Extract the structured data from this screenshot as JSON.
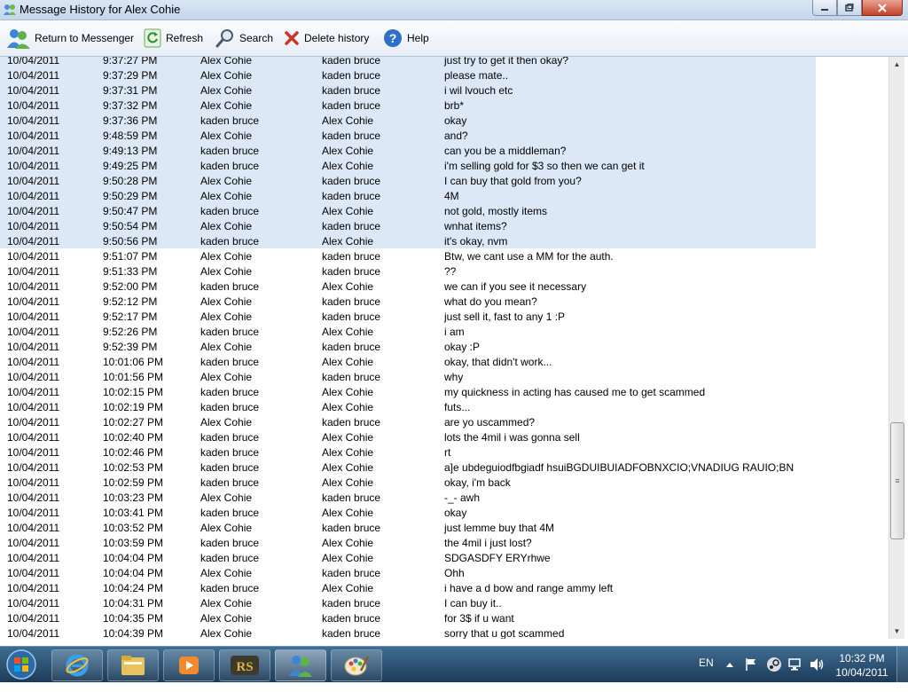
{
  "window": {
    "title": "Message History for Alex Cohie"
  },
  "toolbar": {
    "return": "Return to Messenger",
    "refresh": "Refresh",
    "search": "Search",
    "delete": "Delete history",
    "help": "Help"
  },
  "messages": [
    {
      "date": "10/04/2011",
      "time": "9:37:27 PM",
      "from": "Alex Cohie",
      "to": "kaden bruce",
      "text": "just try to get it then okay?",
      "selected": true
    },
    {
      "date": "10/04/2011",
      "time": "9:37:29 PM",
      "from": "Alex Cohie",
      "to": "kaden bruce",
      "text": "please mate..",
      "selected": true
    },
    {
      "date": "10/04/2011",
      "time": "9:37:31 PM",
      "from": "Alex Cohie",
      "to": "kaden bruce",
      "text": "i wil lvouch etc",
      "selected": true
    },
    {
      "date": "10/04/2011",
      "time": "9:37:32 PM",
      "from": "Alex Cohie",
      "to": "kaden bruce",
      "text": "brb*",
      "selected": true
    },
    {
      "date": "10/04/2011",
      "time": "9:37:36 PM",
      "from": "kaden bruce",
      "to": "Alex Cohie",
      "text": "okay",
      "selected": true
    },
    {
      "date": "10/04/2011",
      "time": "9:48:59 PM",
      "from": "Alex Cohie",
      "to": "kaden bruce",
      "text": "and?",
      "selected": true
    },
    {
      "date": "10/04/2011",
      "time": "9:49:13 PM",
      "from": "kaden bruce",
      "to": "Alex Cohie",
      "text": "can you be a middleman?",
      "selected": true
    },
    {
      "date": "10/04/2011",
      "time": "9:49:25 PM",
      "from": "kaden bruce",
      "to": "Alex Cohie",
      "text": "i'm selling gold for $3 so then we can get it",
      "selected": true
    },
    {
      "date": "10/04/2011",
      "time": "9:50:28 PM",
      "from": "Alex Cohie",
      "to": "kaden bruce",
      "text": "I can buy that gold from you?",
      "selected": true
    },
    {
      "date": "10/04/2011",
      "time": "9:50:29 PM",
      "from": "Alex Cohie",
      "to": "kaden bruce",
      "text": "4M",
      "selected": true
    },
    {
      "date": "10/04/2011",
      "time": "9:50:47 PM",
      "from": "kaden bruce",
      "to": "Alex Cohie",
      "text": "not gold, mostly items",
      "selected": true
    },
    {
      "date": "10/04/2011",
      "time": "9:50:54 PM",
      "from": "Alex Cohie",
      "to": "kaden bruce",
      "text": "wnhat items?",
      "selected": true
    },
    {
      "date": "10/04/2011",
      "time": "9:50:56 PM",
      "from": "kaden bruce",
      "to": "Alex Cohie",
      "text": "it's okay, nvm",
      "selected": true
    },
    {
      "date": "10/04/2011",
      "time": "9:51:07 PM",
      "from": "Alex Cohie",
      "to": "kaden bruce",
      "text": "Btw, we cant use a MM for the auth.",
      "selected": false
    },
    {
      "date": "10/04/2011",
      "time": "9:51:33 PM",
      "from": "Alex Cohie",
      "to": "kaden bruce",
      "text": "??",
      "selected": false
    },
    {
      "date": "10/04/2011",
      "time": "9:52:00 PM",
      "from": "kaden bruce",
      "to": "Alex Cohie",
      "text": "we can if you see it necessary",
      "selected": false
    },
    {
      "date": "10/04/2011",
      "time": "9:52:12 PM",
      "from": "Alex Cohie",
      "to": "kaden bruce",
      "text": "what do you mean?",
      "selected": false
    },
    {
      "date": "10/04/2011",
      "time": "9:52:17 PM",
      "from": "Alex Cohie",
      "to": "kaden bruce",
      "text": "just sell it, fast to any 1 :P",
      "selected": false
    },
    {
      "date": "10/04/2011",
      "time": "9:52:26 PM",
      "from": "kaden bruce",
      "to": "Alex Cohie",
      "text": "i am",
      "selected": false
    },
    {
      "date": "10/04/2011",
      "time": "9:52:39 PM",
      "from": "Alex Cohie",
      "to": "kaden bruce",
      "text": "okay :P",
      "selected": false
    },
    {
      "date": "10/04/2011",
      "time": "10:01:06 PM",
      "from": "kaden bruce",
      "to": "Alex Cohie",
      "text": "okay, that didn't work...",
      "selected": false
    },
    {
      "date": "10/04/2011",
      "time": "10:01:56 PM",
      "from": "Alex Cohie",
      "to": "kaden bruce",
      "text": "why",
      "selected": false
    },
    {
      "date": "10/04/2011",
      "time": "10:02:15 PM",
      "from": "kaden bruce",
      "to": "Alex Cohie",
      "text": "my quickness in acting has caused me to get scammed",
      "selected": false
    },
    {
      "date": "10/04/2011",
      "time": "10:02:19 PM",
      "from": "kaden bruce",
      "to": "Alex Cohie",
      "text": "futs...",
      "selected": false
    },
    {
      "date": "10/04/2011",
      "time": "10:02:27 PM",
      "from": "Alex Cohie",
      "to": "kaden bruce",
      "text": "are yo uscammed?",
      "selected": false
    },
    {
      "date": "10/04/2011",
      "time": "10:02:40 PM",
      "from": "kaden bruce",
      "to": "Alex Cohie",
      "text": "lots the 4mil i was gonna sell",
      "selected": false
    },
    {
      "date": "10/04/2011",
      "time": "10:02:46 PM",
      "from": "kaden bruce",
      "to": "Alex Cohie",
      "text": "rt",
      "selected": false
    },
    {
      "date": "10/04/2011",
      "time": "10:02:53 PM",
      "from": "kaden bruce",
      "to": "Alex Cohie",
      "text": "a]e ubdeguiodfbgiadf hsuiBGDUIBUIADFOBNXCIO;VNADIUG RAUIO;BN",
      "selected": false
    },
    {
      "date": "10/04/2011",
      "time": "10:02:59 PM",
      "from": "kaden bruce",
      "to": "Alex Cohie",
      "text": "okay, i'm back",
      "selected": false
    },
    {
      "date": "10/04/2011",
      "time": "10:03:23 PM",
      "from": "Alex Cohie",
      "to": "kaden bruce",
      "text": "-_- awh",
      "selected": false
    },
    {
      "date": "10/04/2011",
      "time": "10:03:41 PM",
      "from": "kaden bruce",
      "to": "Alex Cohie",
      "text": "okay",
      "selected": false
    },
    {
      "date": "10/04/2011",
      "time": "10:03:52 PM",
      "from": "Alex Cohie",
      "to": "kaden bruce",
      "text": "just lemme buy that 4M",
      "selected": false
    },
    {
      "date": "10/04/2011",
      "time": "10:03:59 PM",
      "from": "kaden bruce",
      "to": "Alex Cohie",
      "text": "the 4mil i just lost?",
      "selected": false
    },
    {
      "date": "10/04/2011",
      "time": "10:04:04 PM",
      "from": "kaden bruce",
      "to": "Alex Cohie",
      "text": "SDGASDFY ERYrhwe",
      "selected": false
    },
    {
      "date": "10/04/2011",
      "time": "10:04:04 PM",
      "from": "Alex Cohie",
      "to": "kaden bruce",
      "text": "Ohh",
      "selected": false
    },
    {
      "date": "10/04/2011",
      "time": "10:04:24 PM",
      "from": "kaden bruce",
      "to": "Alex Cohie",
      "text": "i have a d bow and range ammy left",
      "selected": false
    },
    {
      "date": "10/04/2011",
      "time": "10:04:31 PM",
      "from": "Alex Cohie",
      "to": "kaden bruce",
      "text": "I can buy it..",
      "selected": false
    },
    {
      "date": "10/04/2011",
      "time": "10:04:35 PM",
      "from": "Alex Cohie",
      "to": "kaden bruce",
      "text": "for 3$ if u want",
      "selected": false
    },
    {
      "date": "10/04/2011",
      "time": "10:04:39 PM",
      "from": "Alex Cohie",
      "to": "kaden bruce",
      "text": "sorry that u got scammed",
      "selected": false
    }
  ],
  "taskbar": {
    "items": [
      "internet-explorer-icon",
      "file-explorer-icon",
      "media-player-icon",
      "runescape-icon",
      "messenger-icon",
      "paint-icon"
    ],
    "active_item": "messenger-icon",
    "lang": "EN",
    "time": "10:32 PM",
    "date": "10/04/2011"
  },
  "colors": {
    "selection": "#dce8f6",
    "taskbar": "#2a4c6e"
  }
}
